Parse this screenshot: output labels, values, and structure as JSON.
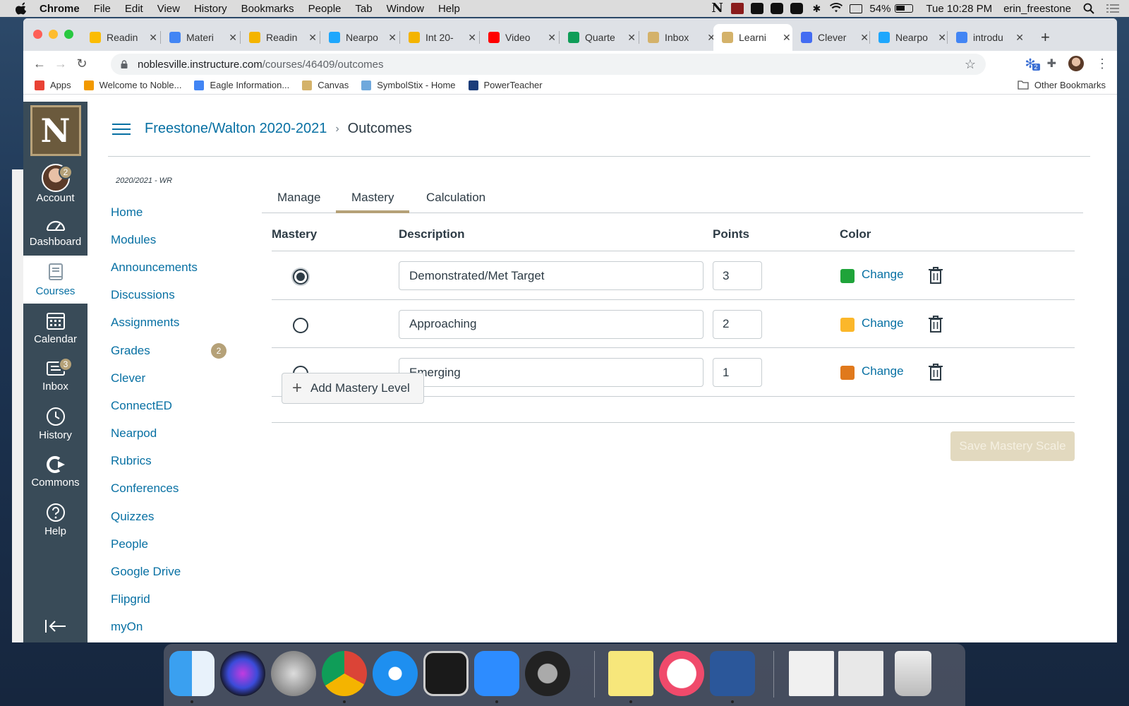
{
  "menubar": {
    "app": "Chrome",
    "items": [
      "File",
      "Edit",
      "View",
      "History",
      "Bookmarks",
      "People",
      "Tab",
      "Window",
      "Help"
    ],
    "battery": "54%",
    "clock": "Tue 10:28 PM",
    "user": "erin_freestone"
  },
  "browser": {
    "tabs": [
      {
        "title": "Readin",
        "color": "#fbbc04"
      },
      {
        "title": "Materi",
        "color": "#4285f4"
      },
      {
        "title": "Readin",
        "color": "#f4b400"
      },
      {
        "title": "Nearpo",
        "color": "#1ea7fd"
      },
      {
        "title": "Int 20-",
        "color": "#f4b400"
      },
      {
        "title": "Video",
        "color": "#ff0000"
      },
      {
        "title": "Quarte",
        "color": "#0f9d58"
      },
      {
        "title": "Inbox",
        "color": "#d4b26a"
      },
      {
        "title": "Learni",
        "color": "#d4b26a"
      },
      {
        "title": "Clever",
        "color": "#436cf2"
      },
      {
        "title": "Nearpo",
        "color": "#1ea7fd"
      },
      {
        "title": "introdu",
        "color": "#4285f4"
      }
    ],
    "url_host": "noblesville.instructure.com",
    "url_path": "/courses/46409/outcomes",
    "extension_badge": "2",
    "bookmarks": [
      {
        "label": "Apps",
        "color": "#e94235"
      },
      {
        "label": "Welcome to Noble...",
        "color": "#f29900"
      },
      {
        "label": "Eagle Information...",
        "color": "#4285f4"
      },
      {
        "label": "Canvas",
        "color": "#d4b26a"
      },
      {
        "label": "SymbolStix - Home",
        "color": "#6fa8dc"
      },
      {
        "label": "PowerTeacher",
        "color": "#1c3d7a"
      }
    ],
    "other_bookmarks": "Other Bookmarks"
  },
  "global_nav": {
    "logo_letter": "N",
    "items": [
      {
        "label": "Account",
        "badge": "2"
      },
      {
        "label": "Dashboard",
        "badge": ""
      },
      {
        "label": "Courses",
        "badge": ""
      },
      {
        "label": "Calendar",
        "badge": ""
      },
      {
        "label": "Inbox",
        "badge": "3"
      },
      {
        "label": "History",
        "badge": ""
      },
      {
        "label": "Commons",
        "badge": ""
      },
      {
        "label": "Help",
        "badge": ""
      }
    ]
  },
  "breadcrumb": {
    "course": "Freestone/Walton 2020-2021",
    "current": "Outcomes"
  },
  "course_nav": {
    "term": "2020/2021 - WR",
    "items": [
      "Home",
      "Modules",
      "Announcements",
      "Discussions",
      "Assignments",
      "Grades",
      "Clever",
      "ConnectED",
      "Nearpod",
      "Rubrics",
      "Conferences",
      "Quizzes",
      "People",
      "Google Drive",
      "Flipgrid",
      "myOn"
    ],
    "grades_badge": "2"
  },
  "content_tabs": {
    "manage": "Manage",
    "mastery": "Mastery",
    "calculation": "Calculation"
  },
  "mastery_table": {
    "headers": {
      "mastery": "Mastery",
      "description": "Description",
      "points": "Points",
      "color": "Color"
    },
    "rows": [
      {
        "description": "Demonstrated/Met Target",
        "points": "3",
        "color": "#1fa43a",
        "change": "Change",
        "selected": true
      },
      {
        "description": "Approaching",
        "points": "2",
        "color": "#fbb72a",
        "change": "Change",
        "selected": false
      },
      {
        "description": "Emerging",
        "points": "1",
        "color": "#e0791c",
        "change": "Change",
        "selected": false
      }
    ]
  },
  "actions": {
    "add_level": "Add Mastery Level",
    "save": "Save Mastery Scale"
  }
}
